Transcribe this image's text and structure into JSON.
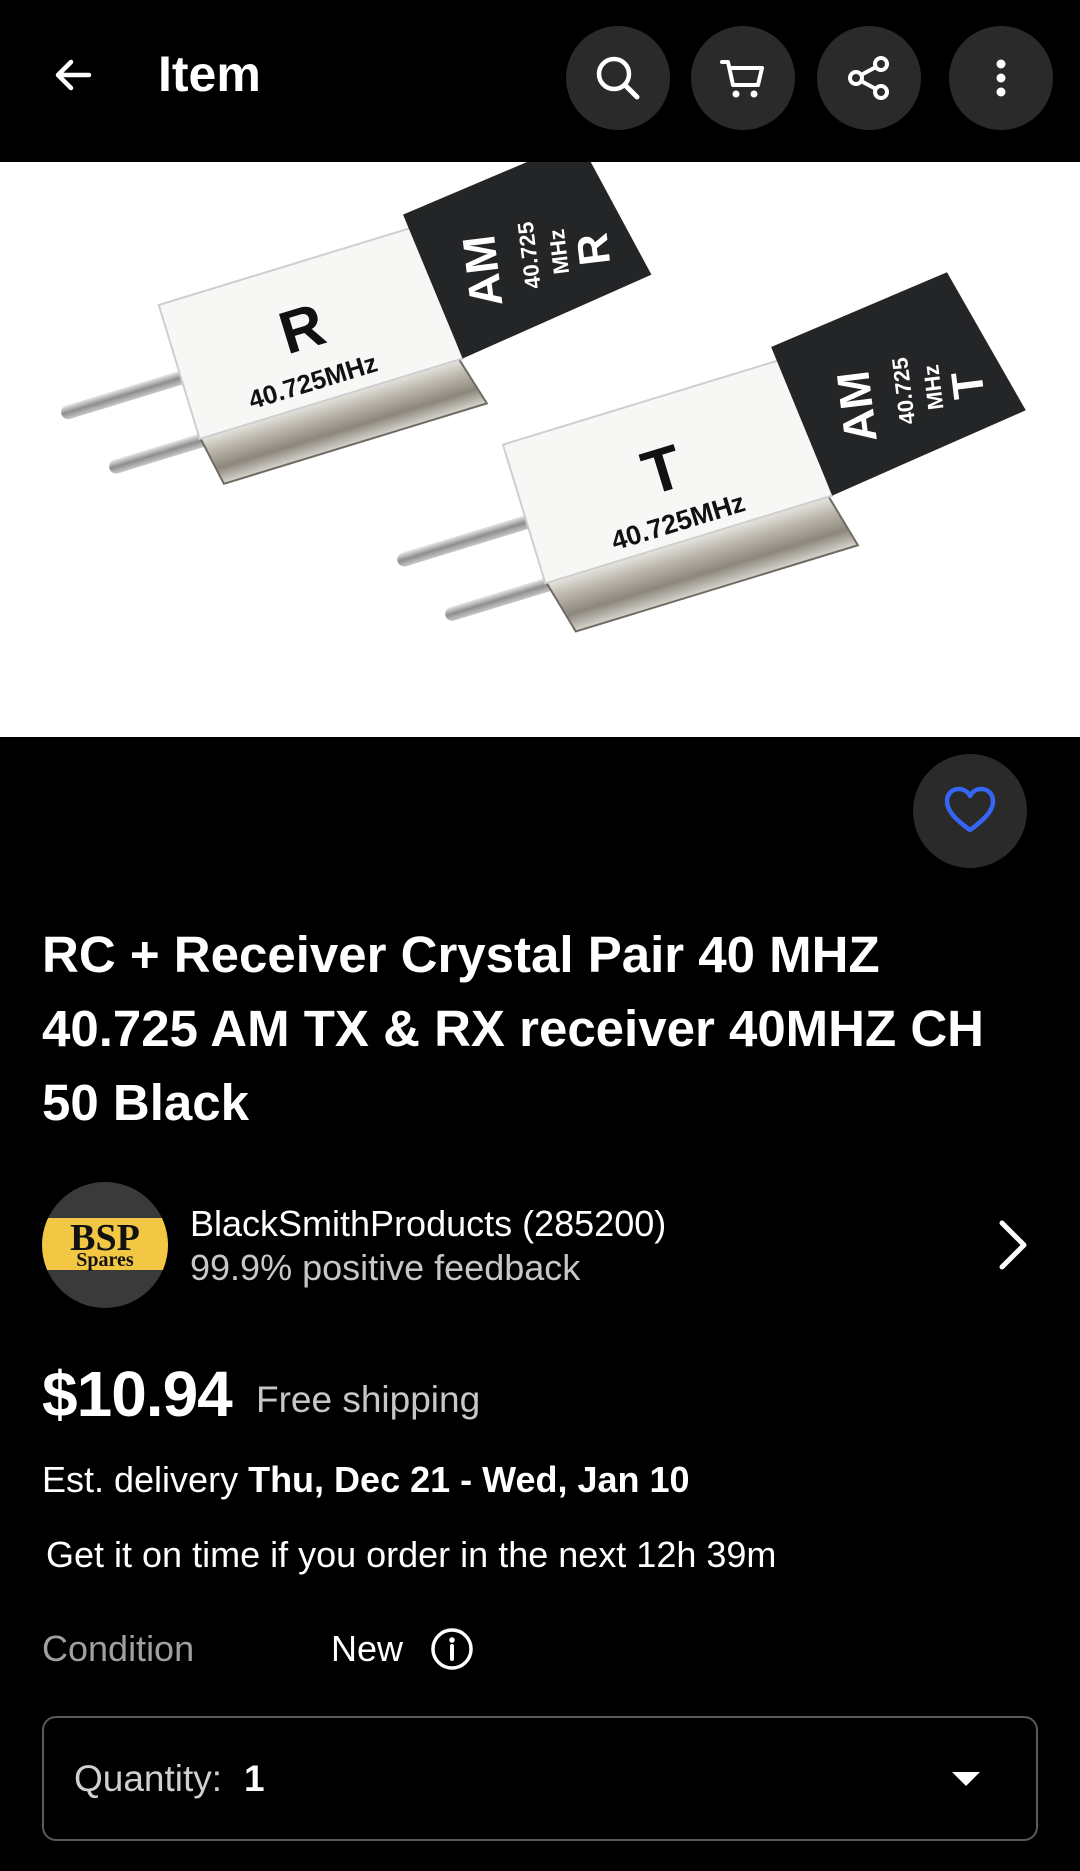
{
  "header": {
    "title": "Item",
    "back_icon": "arrow-left-icon",
    "actions": [
      "search-icon",
      "cart-icon",
      "share-icon",
      "more-vertical-icon"
    ]
  },
  "hero": {
    "left_crystal": {
      "big_letter": "R",
      "freq": "40.725MHz",
      "band": "AM",
      "tag_freq": "40.725",
      "tag_unit": "MHz",
      "tag_letter": "R"
    },
    "right_crystal": {
      "big_letter": "T",
      "freq": "40.725MHz",
      "band": "AM",
      "tag_freq": "40.725",
      "tag_unit": "MHz",
      "tag_letter": "T"
    }
  },
  "favorite": {
    "icon": "heart-outline-icon",
    "color": "#3665f3"
  },
  "product": {
    "title": "RC + Receiver Crystal Pair 40 MHZ 40.725 AM TX & RX receiver 40MHZ CH 50 Black"
  },
  "seller": {
    "logo_text_top": "BSP",
    "logo_text_bottom": "Spares",
    "name": "BlackSmithProducts (285200)",
    "feedback": "99.9% positive feedback"
  },
  "pricing": {
    "price": "$10.94",
    "shipping": "Free shipping"
  },
  "delivery": {
    "prefix": "Est. delivery ",
    "range": "Thu, Dec 21 - Wed, Jan 10",
    "cutoff": "Get it on time if you order in the next 12h 39m"
  },
  "condition": {
    "label": "Condition",
    "value": "New"
  },
  "quantity": {
    "label": "Quantity:",
    "value": "1"
  },
  "colors": {
    "background": "#000000",
    "button_bg": "#2a2a2a",
    "accent": "#3665f3",
    "muted_text": "#c7c7c7"
  }
}
